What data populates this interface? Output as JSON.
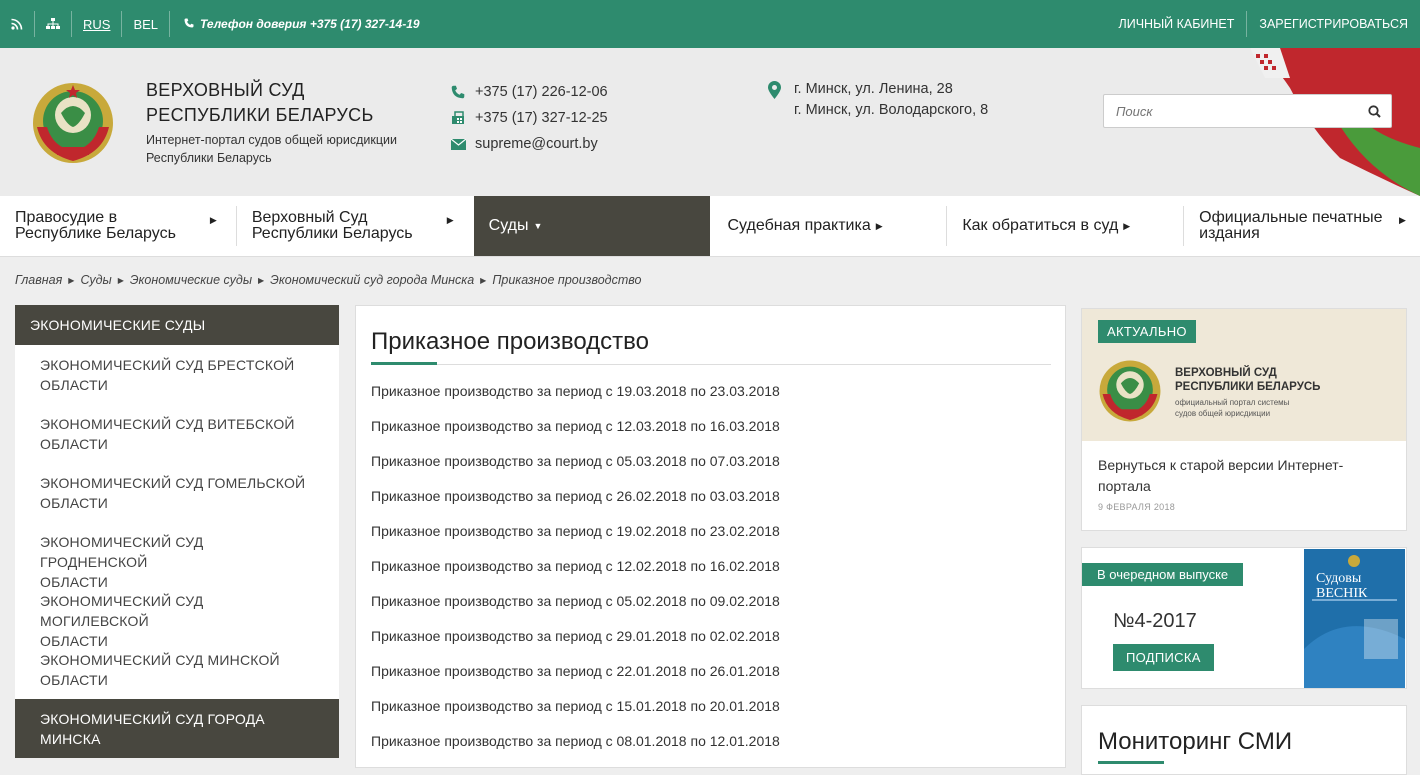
{
  "topbar": {
    "lang_rus": "RUS",
    "lang_bel": "BEL",
    "hotline": "Телефон доверия +375 (17) 327-14-19",
    "cabinet": "ЛИЧНЫЙ КАБИНЕТ",
    "register": "ЗАРЕГИСТРИРОВАТЬСЯ"
  },
  "header": {
    "title_line1": "ВЕРХОВНЫЙ СУД",
    "title_line2": "РЕСПУБЛИКИ БЕЛАРУСЬ",
    "subtitle_line1": "Интернет-портал судов общей юрисдикции",
    "subtitle_line2": "Республики Беларусь",
    "phone1": "+375 (17) 226-12-06",
    "phone2": "+375 (17) 327-12-25",
    "email": "supreme@court.by",
    "address1": "г. Минск, ул. Ленина, 28",
    "address2": "г. Минск, ул. Володарского, 8",
    "search_placeholder": "Поиск"
  },
  "nav": {
    "items": [
      {
        "line1": "Правосудие в",
        "line2": "Республике Беларусь"
      },
      {
        "line1": "Верховный Суд",
        "line2": "Республики Беларусь"
      },
      {
        "line1": "Суды",
        "line2": ""
      },
      {
        "line1": "Судебная практика",
        "line2": ""
      },
      {
        "line1": "Как обратиться в суд",
        "line2": ""
      },
      {
        "line1": "Официальные печатные",
        "line2": "издания"
      }
    ]
  },
  "breadcrumb": [
    "Главная",
    "Суды",
    "Экономические суды",
    "Экономический суд города Минска",
    "Приказное производство"
  ],
  "sidebar": {
    "heading": "ЭКОНОМИЧЕСКИЕ СУДЫ",
    "items": [
      {
        "line1": "ЭКОНОМИЧЕСКИЙ СУД БРЕСТСКОЙ",
        "line2": "ОБЛАСТИ"
      },
      {
        "line1": "ЭКОНОМИЧЕСКИЙ СУД ВИТЕБСКОЙ",
        "line2": "ОБЛАСТИ"
      },
      {
        "line1": "ЭКОНОМИЧЕСКИЙ СУД ГОМЕЛЬСКОЙ",
        "line2": "ОБЛАСТИ"
      },
      {
        "line1": "ЭКОНОМИЧЕСКИЙ СУД ГРОДНЕНСКОЙ",
        "line2": "ОБЛАСТИ"
      },
      {
        "line1": "ЭКОНОМИЧЕСКИЙ СУД МОГИЛЕВСКОЙ",
        "line2": "ОБЛАСТИ"
      },
      {
        "line1": "ЭКОНОМИЧЕСКИЙ СУД МИНСКОЙ",
        "line2": "ОБЛАСТИ"
      },
      {
        "line1": "ЭКОНОМИЧЕСКИЙ СУД ГОРОДА",
        "line2": "МИНСКА"
      }
    ]
  },
  "main": {
    "title": "Приказное производство",
    "items": [
      "Приказное производство за период с 19.03.2018 по 23.03.2018",
      "Приказное производство за период с 12.03.2018 по 16.03.2018",
      "Приказное производство за период с 05.03.2018 по 07.03.2018",
      "Приказное производство за период с 26.02.2018 по 03.03.2018",
      "Приказное производство за период с 19.02.2018 по 23.02.2018",
      "Приказное производство за период с 12.02.2018 по 16.02.2018",
      "Приказное производство за период с 05.02.2018 по 09.02.2018",
      "Приказное производство за период с 29.01.2018 по 02.02.2018",
      "Приказное производство за период с 22.01.2018 по 26.01.2018",
      "Приказное производство за период с 15.01.2018 по 20.01.2018",
      "Приказное производство за период с 08.01.2018 по 12.01.2018"
    ]
  },
  "actual": {
    "badge": "АКТУАЛЬНО",
    "img_title1": "ВЕРХОВНЫЙ СУД",
    "img_title2": "РЕСПУБЛИКИ БЕЛАРУСЬ",
    "img_sub1": "официальный портал системы",
    "img_sub2": "судов общей юрисдикции",
    "text": "Вернуться к старой версии Интернет-портала",
    "date": "9 ФЕВРАЛЯ 2018"
  },
  "issue": {
    "badge": "В очередном выпуске",
    "number": "№4-2017",
    "subscribe": "ПОДПИСКА",
    "cover_line1": "Судовы",
    "cover_line2": "ВЕСНІК"
  },
  "smi": {
    "title": "Мониторинг СМИ"
  },
  "colors": {
    "accent": "#2e8b6e",
    "dark": "#48473f"
  }
}
